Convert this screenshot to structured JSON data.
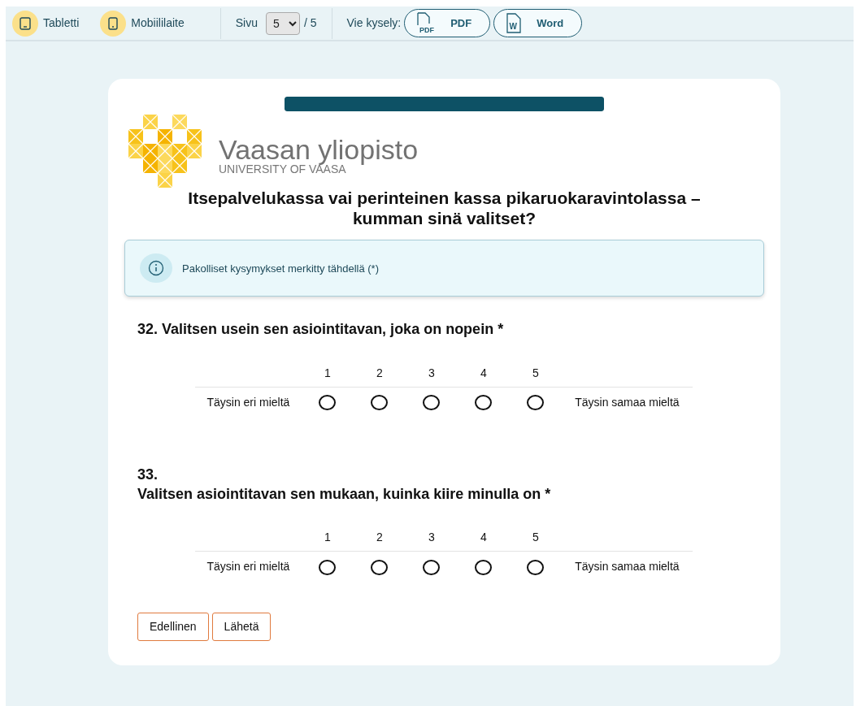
{
  "toolbar": {
    "devices": [
      {
        "label": "Tabletti",
        "kind": "tablet"
      },
      {
        "label": "Mobiililaite",
        "kind": "phone"
      }
    ],
    "page_label": "Sivu",
    "page_value": "5",
    "page_total": "/ 5",
    "export_label": "Vie kysely:",
    "export_buttons": [
      {
        "label": "PDF",
        "kind": "pdf",
        "icon_text": "PDF"
      },
      {
        "label": "Word",
        "kind": "word",
        "icon_text": "W"
      }
    ]
  },
  "survey": {
    "progress": {
      "level": 1
    },
    "logo": {
      "name": "Vaasan yliopisto",
      "subtitle": "UNIVERSITY OF VAASA"
    },
    "title": "Itsepalvelukassa vai perinteinen kassa pikaruokaravintolassa – kumman sinä valitset?",
    "notice": "Pakolliset kysymykset merkitty tähdellä (*)",
    "questions": [
      {
        "number": "32.",
        "text": "Valitsen usein sen asiointitavan, joka on nopein *",
        "wrapped": false,
        "left_label": "Täysin eri mieltä",
        "right_label": "Täysin samaa mieltä",
        "options": [
          {
            "label": "1",
            "selected": false
          },
          {
            "label": "2",
            "selected": false
          },
          {
            "label": "3",
            "selected": false
          },
          {
            "label": "4",
            "selected": false
          },
          {
            "label": "5",
            "selected": false
          }
        ]
      },
      {
        "number": "33.",
        "text": "Valitsen asiointitavan sen mukaan, kuinka kiire minulla on *",
        "wrapped": true,
        "left_label": "Täysin eri mieltä",
        "right_label": "Täysin samaa mieltä",
        "options": [
          {
            "label": "1",
            "selected": false
          },
          {
            "label": "2",
            "selected": false
          },
          {
            "label": "3",
            "selected": false
          },
          {
            "label": "4",
            "selected": false
          },
          {
            "label": "5",
            "selected": false
          }
        ]
      }
    ],
    "buttons": [
      "Edellinen",
      "Lähetä"
    ]
  }
}
